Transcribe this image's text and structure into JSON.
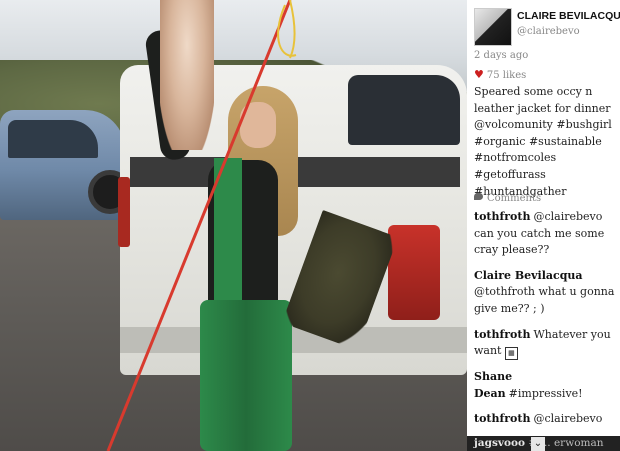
{
  "profile": {
    "name": "CLAIRE BEVILACQUA",
    "handle": "@clairebevo"
  },
  "post": {
    "time": "2 days ago",
    "likes": "75 likes",
    "caption": "Speared some occy n leather jacket for dinner @volcomunity #bushgirl #organic #sustainable #notfromcoles #getoffurass #huntandgather"
  },
  "comments_header": "Comments",
  "comments": [
    {
      "user": "tothfroth",
      "text": "@clairebevo can you catch me some cray please??"
    },
    {
      "user": "Claire Bevilacqua",
      "text": "@tothfroth what u gonna give me?? ; )"
    },
    {
      "user": "tothfroth",
      "text": "Whatever you want"
    },
    {
      "user": "Shane Dean",
      "text": "#impressive!"
    },
    {
      "user": "tothfroth",
      "text": "@clairebevo"
    }
  ],
  "bottom_bar": {
    "user": "jagsvooo",
    "text": "#f... erwoman"
  },
  "icons": {
    "like": "heart-icon",
    "comments": "speech-bubble-icon",
    "expand": "chevron-down-icon"
  },
  "colors": {
    "heart": "#cc1f1f",
    "wetsuit_green": "#2d8a4a",
    "spear_red": "#d83a2e"
  }
}
